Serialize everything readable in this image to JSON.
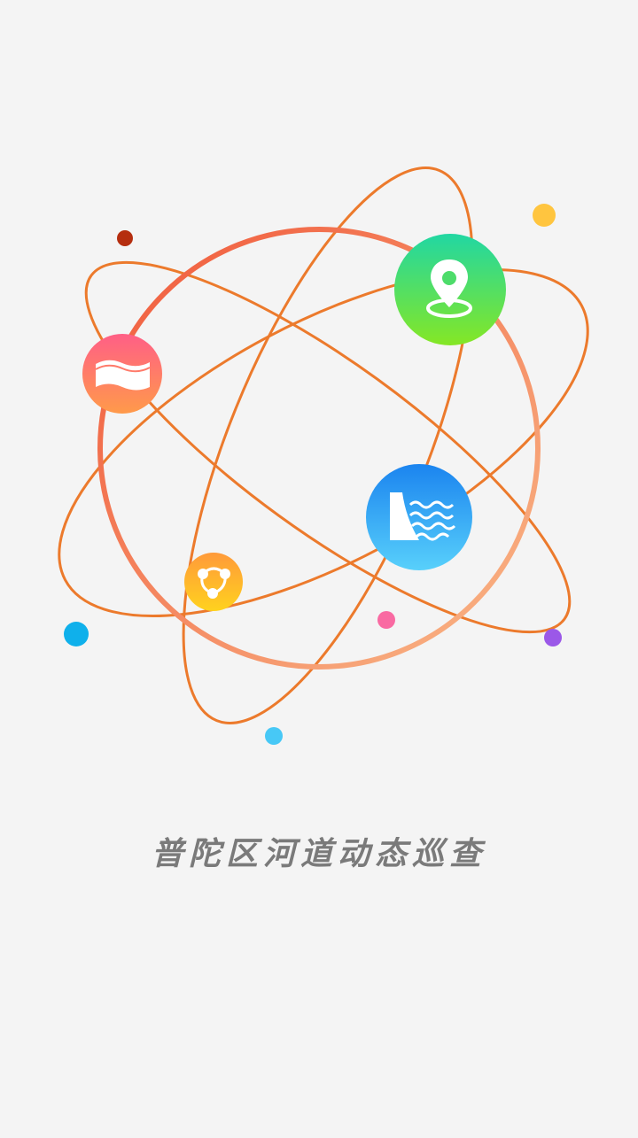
{
  "app": {
    "title": "普陀区河道动态巡查"
  },
  "colors": {
    "background": "#f4f4f4",
    "orbit_line": "#ec7a2c",
    "big_ring_start": "#f06a3a",
    "big_ring_end": "#f8b07c",
    "title_text": "#7a7a7a"
  },
  "icons": [
    {
      "name": "location-pin-icon",
      "gradient": [
        "#21d7a3",
        "#85e725"
      ]
    },
    {
      "name": "river-flag-icon",
      "gradient": [
        "#ff5f86",
        "#ff9a4a"
      ]
    },
    {
      "name": "dam-water-icon",
      "gradient": [
        "#1b84ef",
        "#58d0fb"
      ]
    },
    {
      "name": "share-network-icon",
      "gradient": [
        "#ff9a3a",
        "#ffd21e"
      ]
    }
  ],
  "dots": [
    {
      "name": "dot-dark-red",
      "color": "#b52e0f"
    },
    {
      "name": "dot-yellow",
      "color": "#ffc53f"
    },
    {
      "name": "dot-cyan",
      "color": "#0fb0eb"
    },
    {
      "name": "dot-pink",
      "color": "#f96aa2"
    },
    {
      "name": "dot-purple",
      "color": "#9b58e8"
    },
    {
      "name": "dot-light-blue",
      "color": "#47c8f6"
    }
  ]
}
